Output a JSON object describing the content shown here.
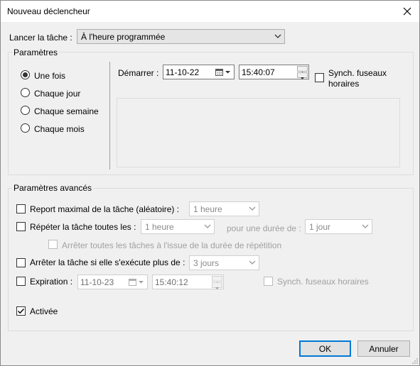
{
  "window": {
    "title": "Nouveau déclencheur"
  },
  "launch": {
    "label": "Lancer la tâche :",
    "value": "À l'heure programmée"
  },
  "settings": {
    "title": "Paramètres",
    "radios": [
      {
        "label": "Une fois",
        "selected": true
      },
      {
        "label": "Chaque jour",
        "selected": false
      },
      {
        "label": "Chaque semaine",
        "selected": false
      },
      {
        "label": "Chaque mois",
        "selected": false
      }
    ],
    "start_label": "Démarrer :",
    "start_date": "11-10-22",
    "start_time": "15:40:07",
    "sync_label_line1": "Synch. fuseaux",
    "sync_label_line2": "horaires"
  },
  "advanced": {
    "title": "Paramètres avancés",
    "delay_label": "Report maximal de la tâche (aléatoire) :",
    "delay_value": "1 heure",
    "repeat_label": "Répéter la tâche toutes les :",
    "repeat_value": "1 heure",
    "duration_label": "pour une durée de :",
    "duration_value": "1 jour",
    "stop_all_label": "Arrêter toutes les tâches à l'issue de la durée de répétition",
    "stop_if_label": "Arrêter la tâche si elle s'exécute plus de :",
    "stop_if_value": "3 jours",
    "expire_label": "Expiration :",
    "expire_date": "11-10-23",
    "expire_time": "15:40:12",
    "expire_sync_label": "Synch. fuseaux horaires",
    "enabled_label": "Activée",
    "enabled_checked": true
  },
  "buttons": {
    "ok": "OK",
    "cancel": "Annuler"
  }
}
